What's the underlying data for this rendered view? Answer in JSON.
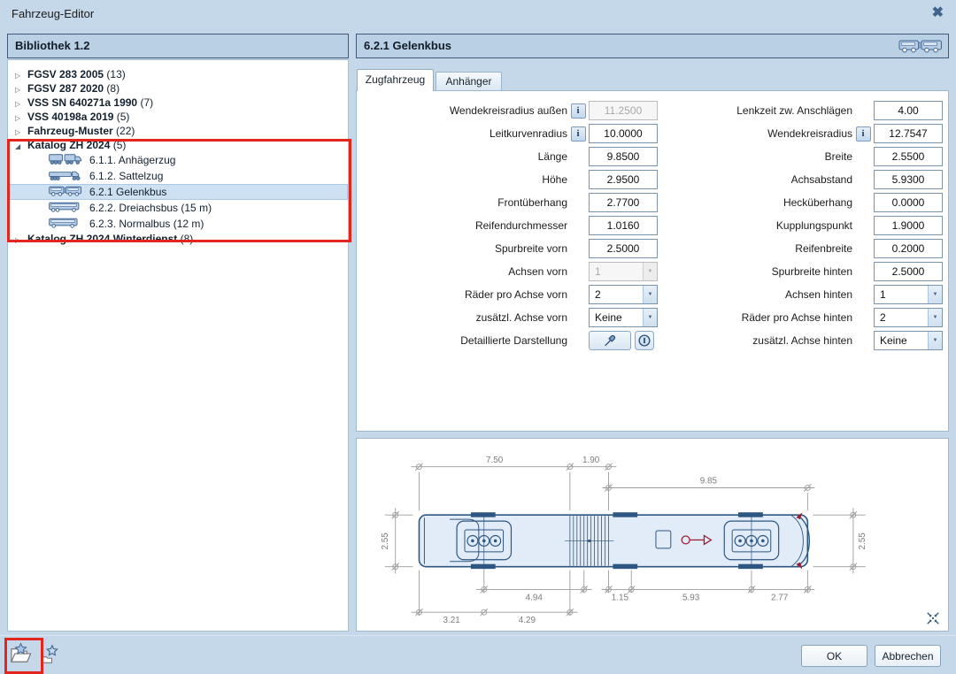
{
  "window": {
    "title": "Fahrzeug-Editor"
  },
  "library": {
    "header": "Bibliothek 1.2",
    "tree": [
      {
        "type": "group",
        "label": "FGSV 283 2005",
        "count": "(13)",
        "expanded": false
      },
      {
        "type": "group",
        "label": "FGSV 287 2020",
        "count": "(8)",
        "expanded": false
      },
      {
        "type": "group",
        "label": "VSS SN 640271a 1990",
        "count": "(7)",
        "expanded": false
      },
      {
        "type": "group",
        "label": "VSS 40198a 2019",
        "count": "(5)",
        "expanded": false
      },
      {
        "type": "group",
        "label": "Fahrzeug-Muster",
        "count": "(22)",
        "expanded": false
      },
      {
        "type": "group",
        "label": "Katalog ZH 2024",
        "count": "(5)",
        "expanded": true
      },
      {
        "type": "item",
        "label": "6.1.1. Anhägerzug",
        "icon": "truck-trailer-icon"
      },
      {
        "type": "item",
        "label": "6.1.2. Sattelzug",
        "icon": "semi-truck-icon"
      },
      {
        "type": "item",
        "label": "6.2.1 Gelenkbus",
        "icon": "articulated-bus-icon",
        "selected": true
      },
      {
        "type": "item",
        "label": "6.2.2. Dreiachsbus (15 m)",
        "icon": "three-axle-bus-icon"
      },
      {
        "type": "item",
        "label": "6.2.3. Normalbus (12 m)",
        "icon": "bus-icon"
      },
      {
        "type": "group",
        "label": "Katalog ZH 2024 Winterdienst",
        "count": "(8)",
        "expanded": false
      }
    ]
  },
  "editor": {
    "header": "6.2.1 Gelenkbus",
    "tabs": {
      "active": "Zugfahrzeug",
      "inactive": "Anhänger"
    },
    "fields_left": [
      {
        "label": "Wendekreisradius außen",
        "info": true,
        "type": "input",
        "value": "11.2500",
        "disabled": true
      },
      {
        "label": "Leitkurvenradius",
        "info": true,
        "type": "input",
        "value": "10.0000"
      },
      {
        "label": "Länge",
        "type": "input",
        "value": "9.8500"
      },
      {
        "label": "Höhe",
        "type": "input",
        "value": "2.9500"
      },
      {
        "label": "Frontüberhang",
        "type": "input",
        "value": "2.7700"
      },
      {
        "label": "Reifendurchmesser",
        "type": "input",
        "value": "1.0160"
      },
      {
        "label": "Spurbreite vorn",
        "type": "input",
        "value": "2.5000"
      },
      {
        "label": "Achsen vorn",
        "type": "select",
        "value": "1",
        "disabled": true
      },
      {
        "label": "Räder pro Achse vorn",
        "type": "select",
        "value": "2"
      },
      {
        "label": "zusätzl. Achse vorn",
        "type": "select",
        "value": "Keine"
      },
      {
        "label": "Detaillierte Darstellung",
        "type": "buttons"
      }
    ],
    "fields_right": [
      {
        "label": "Lenkzeit zw. Anschlägen",
        "type": "input",
        "value": "4.00"
      },
      {
        "label": "Wendekreisradius",
        "info": true,
        "type": "input",
        "value": "12.7547"
      },
      {
        "label": "Breite",
        "type": "input",
        "value": "2.5500"
      },
      {
        "label": "Achsabstand",
        "type": "input",
        "value": "5.9300"
      },
      {
        "label": "Hecküberhang",
        "type": "input",
        "value": "0.0000"
      },
      {
        "label": "Kupplungspunkt",
        "type": "input",
        "value": "1.9000"
      },
      {
        "label": "Reifenbreite",
        "type": "input",
        "value": "0.2000"
      },
      {
        "label": "Spurbreite hinten",
        "type": "input",
        "value": "2.5000"
      },
      {
        "label": "Achsen hinten",
        "type": "select",
        "value": "1"
      },
      {
        "label": "Räder pro Achse hinten",
        "type": "select",
        "value": "2"
      },
      {
        "label": "zusätzl. Achse hinten",
        "type": "select",
        "value": "Keine"
      }
    ],
    "drawing": {
      "dim_front_section": "7.50",
      "dim_articulation": "1.90",
      "dim_rear_section": "9.85",
      "dim_width_left": "2.55",
      "dim_width_right": "2.55",
      "dim_axle_to_joint": "4.94",
      "dim_joint_to_ref": "1.15",
      "dim_rear_wheelbase": "5.93",
      "dim_rear_overhang": "2.77",
      "dim_front_overhang": "3.21",
      "dim_front_wheelbase": "4.29"
    }
  },
  "footer": {
    "ok": "OK",
    "cancel": "Abbrechen"
  },
  "colors": {
    "accent_red": "#e3251e",
    "drawing_blue": "#2d5680",
    "coupling_red": "#9e1c30"
  }
}
